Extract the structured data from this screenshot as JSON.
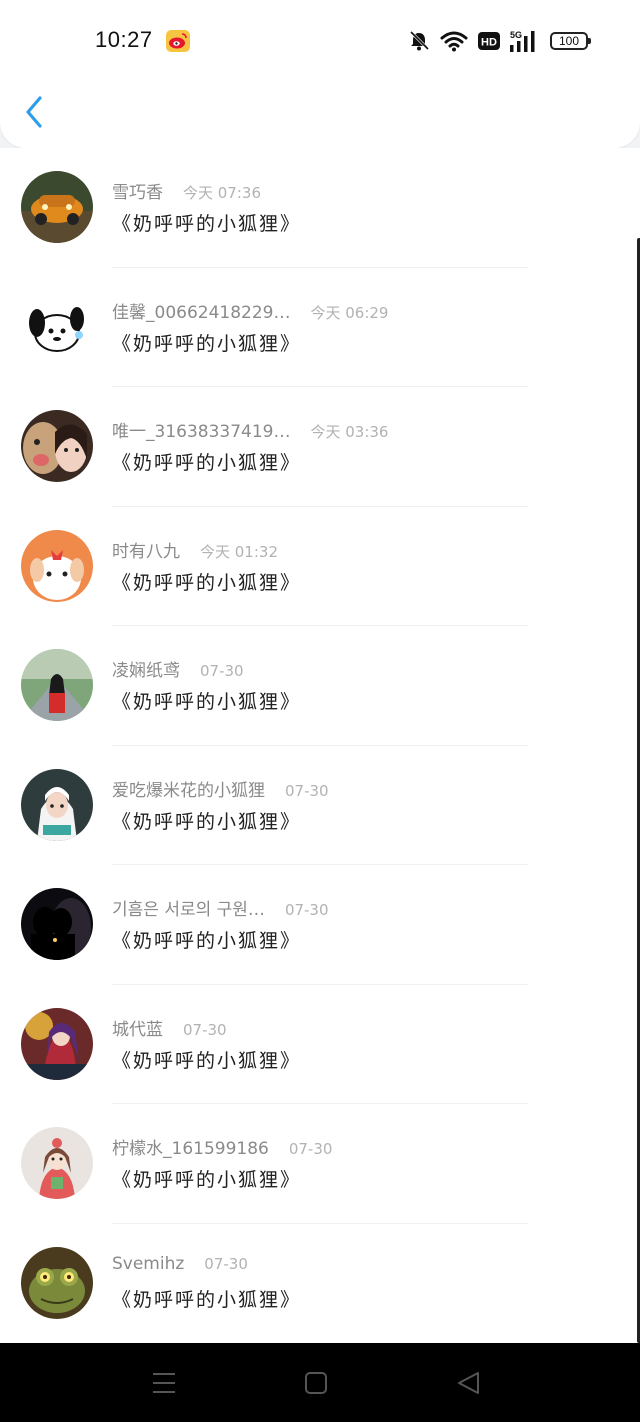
{
  "status_bar": {
    "time": "10:27",
    "battery": "100",
    "network": "5G",
    "hd_label": "HD",
    "icons": [
      "weibo-icon",
      "mute-bell-icon",
      "wifi-icon",
      "hd-icon",
      "signal-icon",
      "battery-icon"
    ]
  },
  "header": {
    "back_icon": "chevron-left-icon",
    "accent_color": "#2d9fea"
  },
  "list": {
    "items": [
      {
        "name": "雪巧香",
        "date": "今天 07:36",
        "message": "《奶呼呼的小狐狸》"
      },
      {
        "name": "佳馨_00662418229…",
        "date": "今天 06:29",
        "message": "《奶呼呼的小狐狸》"
      },
      {
        "name": "唯一_31638337419…",
        "date": "今天 03:36",
        "message": "《奶呼呼的小狐狸》"
      },
      {
        "name": "时有八九",
        "date": "今天 01:32",
        "message": "《奶呼呼的小狐狸》"
      },
      {
        "name": "凌娴纸鸢",
        "date": "07-30",
        "message": "《奶呼呼的小狐狸》"
      },
      {
        "name": "爱吃爆米花的小狐狸",
        "date": "07-30",
        "message": "《奶呼呼的小狐狸》"
      },
      {
        "name": "기흠은 서로의 구원…",
        "date": "07-30",
        "message": "《奶呼呼的小狐狸》"
      },
      {
        "name": "城代蓝",
        "date": "07-30",
        "message": "《奶呼呼的小狐狸》"
      },
      {
        "name": "柠檬水_161599186",
        "date": "07-30",
        "message": "《奶呼呼的小狐狸》"
      },
      {
        "name": "Svemihz",
        "date": "07-30",
        "message": "《奶呼呼的小狐狸》"
      }
    ]
  },
  "nav_bar": {
    "icons": [
      "menu-icon",
      "home-square-icon",
      "back-triangle-icon"
    ]
  }
}
